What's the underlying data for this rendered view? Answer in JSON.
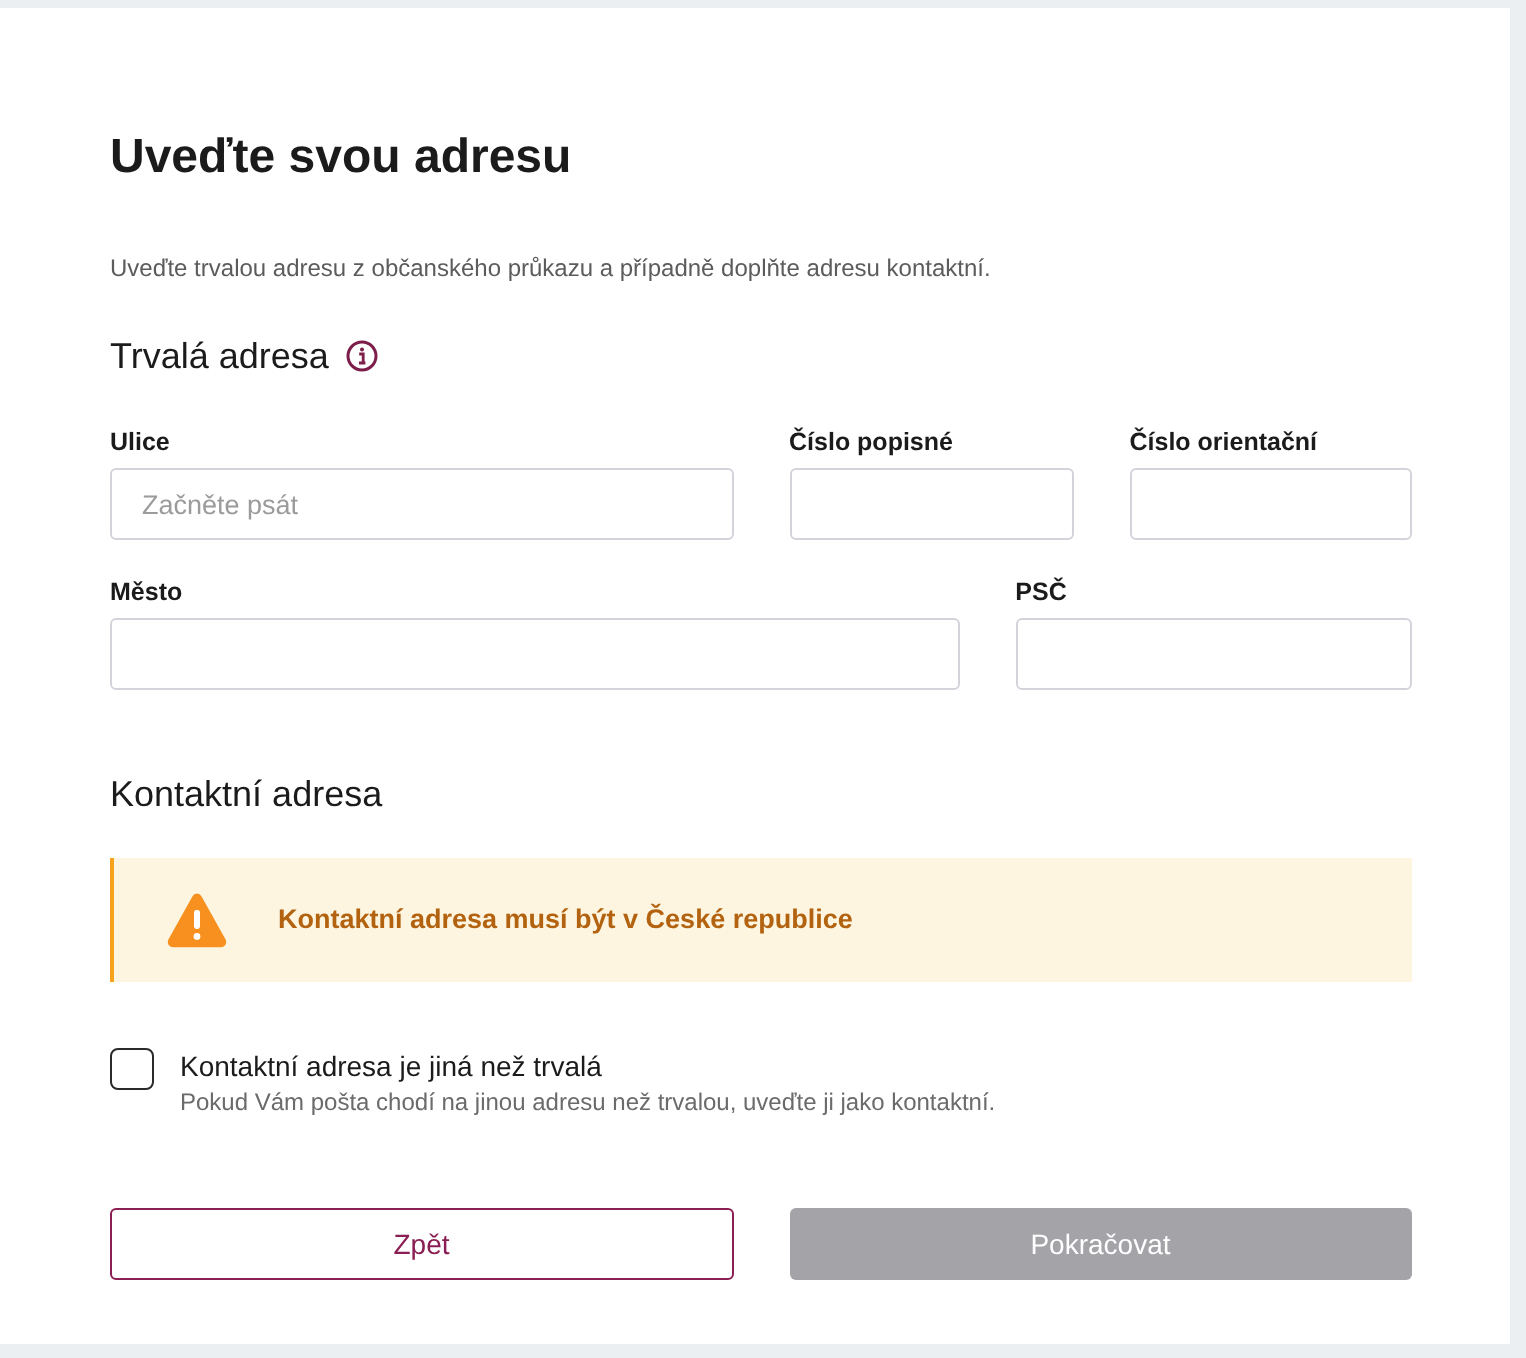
{
  "page": {
    "title": "Uveďte svou adresu",
    "intro": "Uveďte trvalou adresu z občanského průkazu a případně doplňte adresu kontaktní."
  },
  "permanent_address": {
    "heading": "Trvalá adresa",
    "rows": [
      [
        {
          "label": "Ulice",
          "placeholder": "Začněte psát"
        },
        {
          "label": "Číslo popisné"
        },
        {
          "label": "Číslo orientační"
        }
      ],
      [
        {
          "label": "Město"
        },
        {
          "label": "PSČ"
        }
      ]
    ]
  },
  "contact_address": {
    "heading": "Kontaktní adresa",
    "alert": {
      "kind": "warning",
      "text": "Kontaktní adresa musí být v České republice"
    },
    "checkbox": {
      "label": "Kontaktní adresa je jiná než trvalá",
      "description": "Pokud Vám pošta chodí na jinou adresu než trvalou, uveďte ji jako kontaktní.",
      "checked": false
    }
  },
  "buttons": [
    {
      "label": "Zpět",
      "kind": "secondary",
      "disabled": false
    },
    {
      "label": "Pokračovat",
      "kind": "primary",
      "disabled": true
    }
  ]
}
